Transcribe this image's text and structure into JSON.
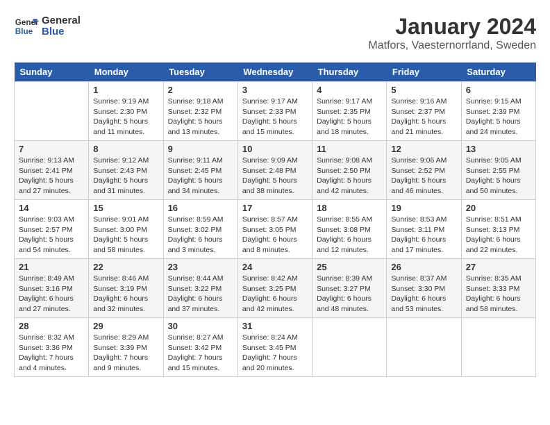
{
  "logo": {
    "line1": "General",
    "line2": "Blue"
  },
  "title": "January 2024",
  "subtitle": "Matfors, Vaesternorrland, Sweden",
  "headers": [
    "Sunday",
    "Monday",
    "Tuesday",
    "Wednesday",
    "Thursday",
    "Friday",
    "Saturday"
  ],
  "weeks": [
    [
      {
        "date": "",
        "lines": []
      },
      {
        "date": "1",
        "lines": [
          "Sunrise: 9:19 AM",
          "Sunset: 2:30 PM",
          "Daylight: 5 hours",
          "and 11 minutes."
        ]
      },
      {
        "date": "2",
        "lines": [
          "Sunrise: 9:18 AM",
          "Sunset: 2:32 PM",
          "Daylight: 5 hours",
          "and 13 minutes."
        ]
      },
      {
        "date": "3",
        "lines": [
          "Sunrise: 9:17 AM",
          "Sunset: 2:33 PM",
          "Daylight: 5 hours",
          "and 15 minutes."
        ]
      },
      {
        "date": "4",
        "lines": [
          "Sunrise: 9:17 AM",
          "Sunset: 2:35 PM",
          "Daylight: 5 hours",
          "and 18 minutes."
        ]
      },
      {
        "date": "5",
        "lines": [
          "Sunrise: 9:16 AM",
          "Sunset: 2:37 PM",
          "Daylight: 5 hours",
          "and 21 minutes."
        ]
      },
      {
        "date": "6",
        "lines": [
          "Sunrise: 9:15 AM",
          "Sunset: 2:39 PM",
          "Daylight: 5 hours",
          "and 24 minutes."
        ]
      }
    ],
    [
      {
        "date": "7",
        "lines": [
          "Sunrise: 9:13 AM",
          "Sunset: 2:41 PM",
          "Daylight: 5 hours",
          "and 27 minutes."
        ]
      },
      {
        "date": "8",
        "lines": [
          "Sunrise: 9:12 AM",
          "Sunset: 2:43 PM",
          "Daylight: 5 hours",
          "and 31 minutes."
        ]
      },
      {
        "date": "9",
        "lines": [
          "Sunrise: 9:11 AM",
          "Sunset: 2:45 PM",
          "Daylight: 5 hours",
          "and 34 minutes."
        ]
      },
      {
        "date": "10",
        "lines": [
          "Sunrise: 9:09 AM",
          "Sunset: 2:48 PM",
          "Daylight: 5 hours",
          "and 38 minutes."
        ]
      },
      {
        "date": "11",
        "lines": [
          "Sunrise: 9:08 AM",
          "Sunset: 2:50 PM",
          "Daylight: 5 hours",
          "and 42 minutes."
        ]
      },
      {
        "date": "12",
        "lines": [
          "Sunrise: 9:06 AM",
          "Sunset: 2:52 PM",
          "Daylight: 5 hours",
          "and 46 minutes."
        ]
      },
      {
        "date": "13",
        "lines": [
          "Sunrise: 9:05 AM",
          "Sunset: 2:55 PM",
          "Daylight: 5 hours",
          "and 50 minutes."
        ]
      }
    ],
    [
      {
        "date": "14",
        "lines": [
          "Sunrise: 9:03 AM",
          "Sunset: 2:57 PM",
          "Daylight: 5 hours",
          "and 54 minutes."
        ]
      },
      {
        "date": "15",
        "lines": [
          "Sunrise: 9:01 AM",
          "Sunset: 3:00 PM",
          "Daylight: 5 hours",
          "and 58 minutes."
        ]
      },
      {
        "date": "16",
        "lines": [
          "Sunrise: 8:59 AM",
          "Sunset: 3:02 PM",
          "Daylight: 6 hours",
          "and 3 minutes."
        ]
      },
      {
        "date": "17",
        "lines": [
          "Sunrise: 8:57 AM",
          "Sunset: 3:05 PM",
          "Daylight: 6 hours",
          "and 8 minutes."
        ]
      },
      {
        "date": "18",
        "lines": [
          "Sunrise: 8:55 AM",
          "Sunset: 3:08 PM",
          "Daylight: 6 hours",
          "and 12 minutes."
        ]
      },
      {
        "date": "19",
        "lines": [
          "Sunrise: 8:53 AM",
          "Sunset: 3:11 PM",
          "Daylight: 6 hours",
          "and 17 minutes."
        ]
      },
      {
        "date": "20",
        "lines": [
          "Sunrise: 8:51 AM",
          "Sunset: 3:13 PM",
          "Daylight: 6 hours",
          "and 22 minutes."
        ]
      }
    ],
    [
      {
        "date": "21",
        "lines": [
          "Sunrise: 8:49 AM",
          "Sunset: 3:16 PM",
          "Daylight: 6 hours",
          "and 27 minutes."
        ]
      },
      {
        "date": "22",
        "lines": [
          "Sunrise: 8:46 AM",
          "Sunset: 3:19 PM",
          "Daylight: 6 hours",
          "and 32 minutes."
        ]
      },
      {
        "date": "23",
        "lines": [
          "Sunrise: 8:44 AM",
          "Sunset: 3:22 PM",
          "Daylight: 6 hours",
          "and 37 minutes."
        ]
      },
      {
        "date": "24",
        "lines": [
          "Sunrise: 8:42 AM",
          "Sunset: 3:25 PM",
          "Daylight: 6 hours",
          "and 42 minutes."
        ]
      },
      {
        "date": "25",
        "lines": [
          "Sunrise: 8:39 AM",
          "Sunset: 3:27 PM",
          "Daylight: 6 hours",
          "and 48 minutes."
        ]
      },
      {
        "date": "26",
        "lines": [
          "Sunrise: 8:37 AM",
          "Sunset: 3:30 PM",
          "Daylight: 6 hours",
          "and 53 minutes."
        ]
      },
      {
        "date": "27",
        "lines": [
          "Sunrise: 8:35 AM",
          "Sunset: 3:33 PM",
          "Daylight: 6 hours",
          "and 58 minutes."
        ]
      }
    ],
    [
      {
        "date": "28",
        "lines": [
          "Sunrise: 8:32 AM",
          "Sunset: 3:36 PM",
          "Daylight: 7 hours",
          "and 4 minutes."
        ]
      },
      {
        "date": "29",
        "lines": [
          "Sunrise: 8:29 AM",
          "Sunset: 3:39 PM",
          "Daylight: 7 hours",
          "and 9 minutes."
        ]
      },
      {
        "date": "30",
        "lines": [
          "Sunrise: 8:27 AM",
          "Sunset: 3:42 PM",
          "Daylight: 7 hours",
          "and 15 minutes."
        ]
      },
      {
        "date": "31",
        "lines": [
          "Sunrise: 8:24 AM",
          "Sunset: 3:45 PM",
          "Daylight: 7 hours",
          "and 20 minutes."
        ]
      },
      {
        "date": "",
        "lines": []
      },
      {
        "date": "",
        "lines": []
      },
      {
        "date": "",
        "lines": []
      }
    ]
  ]
}
